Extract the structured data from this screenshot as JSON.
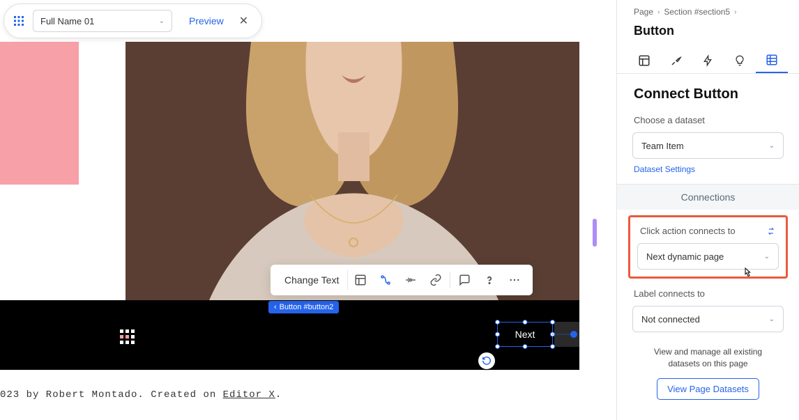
{
  "topbar": {
    "name_select": "Full Name 01",
    "preview": "Preview"
  },
  "canvas": {
    "change_text": "Change Text",
    "button_tag": "Button #button2",
    "selected_button_label": "Next",
    "footer_part1": "023 by Robert Montado. Created on ",
    "footer_link": "Editor X",
    "footer_part2": "."
  },
  "panel": {
    "breadcrumb": {
      "page": "Page",
      "section": "Section #section5"
    },
    "title": "Button",
    "section_title": "Connect Button",
    "choose_dataset_label": "Choose a dataset",
    "dataset_value": "Team Item",
    "dataset_settings": "Dataset Settings",
    "connections_title": "Connections",
    "click_action_label": "Click action connects to",
    "click_action_value": "Next dynamic page",
    "label_connects_label": "Label connects to",
    "label_connects_value": "Not connected",
    "info_text": "View and manage all existing datasets on this page",
    "view_datasets_btn": "View Page Datasets"
  }
}
